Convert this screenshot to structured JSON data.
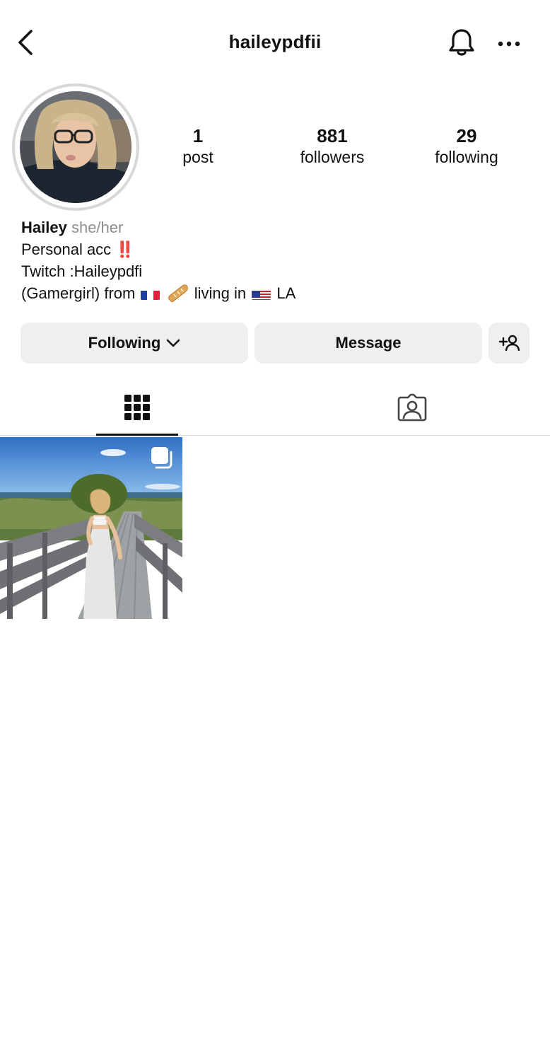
{
  "header": {
    "username": "haileypdfii"
  },
  "profile": {
    "stats": [
      {
        "value": "1",
        "label": "post"
      },
      {
        "value": "881",
        "label": "followers"
      },
      {
        "value": "29",
        "label": "following"
      }
    ],
    "bio": {
      "name": "Hailey",
      "pronouns": "she/her",
      "line1": "Personal acc",
      "line1_emoji": "‼️",
      "line2": "Twitch :Haileypdfi",
      "line3_part1": "(Gamergirl) from",
      "line3_part2": "living in",
      "line3_part3": "LA"
    }
  },
  "actions": {
    "following_label": "Following",
    "message_label": "Message"
  },
  "tabs": [
    {
      "name": "grid-icon",
      "active": true
    },
    {
      "name": "tagged-icon",
      "active": false
    }
  ],
  "colors": {
    "button_bg": "#efefef",
    "avatar_ring": "#d8d8d8",
    "pronoun_gray": "#8e8e8e",
    "exclamation_red": "#e0182d"
  }
}
